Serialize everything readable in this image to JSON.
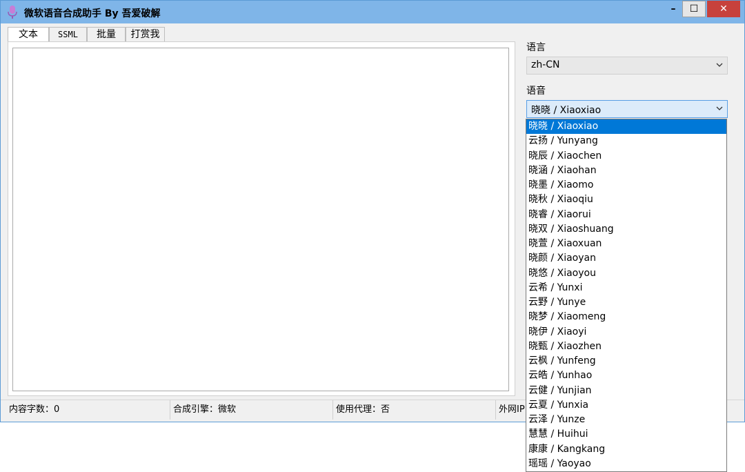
{
  "window": {
    "title": "微软语音合成助手 By 吾爱破解",
    "minimize_glyph": "–",
    "maximize_glyph": "☐",
    "close_glyph": "✕"
  },
  "tabs": [
    {
      "label": "文本",
      "active": true
    },
    {
      "label": "SSML",
      "active": false
    },
    {
      "label": "批量",
      "active": false
    },
    {
      "label": "打赏我",
      "active": false
    }
  ],
  "text_input": {
    "value": ""
  },
  "language": {
    "label": "语言",
    "selected": "zh-CN"
  },
  "voice": {
    "label": "语音",
    "selected": "晓晓 / Xiaoxiao",
    "options": [
      "晓晓 / Xiaoxiao",
      "云扬 / Yunyang",
      "晓辰 / Xiaochen",
      "晓涵 / Xiaohan",
      "晓墨 / Xiaomo",
      "晓秋 / Xiaoqiu",
      "晓睿 / Xiaorui",
      "晓双 / Xiaoshuang",
      "晓萱 / Xiaoxuan",
      "晓颜 / Xiaoyan",
      "晓悠 / Xiaoyou",
      "云希 / Yunxi",
      "云野 / Yunye",
      "晓梦 / Xiaomeng",
      "晓伊 / Xiaoyi",
      "晓甄 / Xiaozhen",
      "云枫 / Yunfeng",
      "云皓 / Yunhao",
      "云健 / Yunjian",
      "云夏 / Yunxia",
      "云泽 / Yunze",
      "慧慧 / Huihui",
      "康康 / Kangkang",
      "瑶瑶 / Yaoyao"
    ]
  },
  "status": {
    "char_count": "内容字数：0",
    "engine": "合成引擎：微软",
    "proxy": "使用代理：否",
    "ip": "外网IP"
  },
  "colors": {
    "titlebar": "#7fb5e8",
    "close_button": "#c7413c",
    "selection": "#0078d7"
  }
}
